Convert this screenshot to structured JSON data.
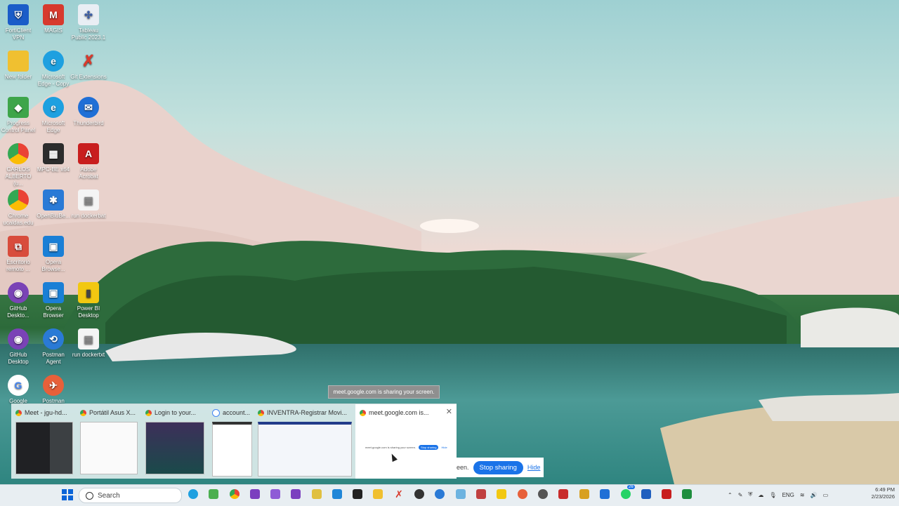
{
  "desktop_icons": [
    {
      "label": "FortiClient VPN",
      "color": "#1a5cc8"
    },
    {
      "label": "MAGIS",
      "color": "#d73a2e"
    },
    {
      "label": "Tableau Public 2023.1",
      "color": "#e9eef4"
    },
    {
      "label": "New folder",
      "color": "#f0c030"
    },
    {
      "label": "Microsoft Edge - Copy",
      "color": "#1ea0e0"
    },
    {
      "label": "Git Extensions",
      "color": "#d83a2c"
    },
    {
      "label": "Progress Control Panel",
      "color": "#3ea54a"
    },
    {
      "label": "Microsoft Edge",
      "color": "#1ea0e0"
    },
    {
      "label": "Thunderbird",
      "color": "#1f6fd6"
    },
    {
      "label": "CARLOS ALBERTO (u...",
      "color": "#e84c2f"
    },
    {
      "label": "MPC-BE x64",
      "color": "#2c2c2c"
    },
    {
      "label": "Adobe Acrobat",
      "color": "#c81e1e"
    },
    {
      "label": "Chrome ucaldas.edu",
      "color": "#e84c2f"
    },
    {
      "label": "OpenBluBe...",
      "color": "#2a7ad6"
    },
    {
      "label": "run dockerbat",
      "color": "#f4f4f4"
    },
    {
      "label": "Escritorio remoto ...",
      "color": "#d84c3c"
    },
    {
      "label": "Opera Browse...",
      "color": "#1a7fd6"
    },
    {
      "label": "GitHub Deskto...",
      "color": "#7a43b6"
    },
    {
      "label": "Opera Browser",
      "color": "#1a7fd6"
    },
    {
      "label": "Power BI Desktop",
      "color": "#f2c811"
    },
    {
      "label": "GitHub Desktop",
      "color": "#7a43b6"
    },
    {
      "label": "Postman Agent",
      "color": "#2a7ad6"
    },
    {
      "label": "run dockertxt",
      "color": "#f4f4f4"
    },
    {
      "label": "Google",
      "color": "#ffffff"
    },
    {
      "label": "Postman",
      "color": "#e7603a"
    }
  ],
  "tooltip": "meet.google.com is sharing your screen.",
  "thumbnails": [
    {
      "title": "Meet - jgu-hd..."
    },
    {
      "title": "Portátil Asus X..."
    },
    {
      "title": "Login to your..."
    },
    {
      "title": "account..."
    },
    {
      "title": "INVENTRA-Registrar Movi..."
    },
    {
      "title": "meet.google.com is..."
    }
  ],
  "sharebar": {
    "fragment": "een.",
    "stop_label": "Stop sharing",
    "hide_label": "Hide",
    "mini_text": "meet.google.com is sharing your screen.",
    "mini_stop": "Stop sharing",
    "mini_hide": "Hide"
  },
  "taskbar": {
    "search_label": "Search",
    "badge_count": "26",
    "lang": "ENG",
    "time": "6:49 PM",
    "date": "2/23/2026"
  }
}
